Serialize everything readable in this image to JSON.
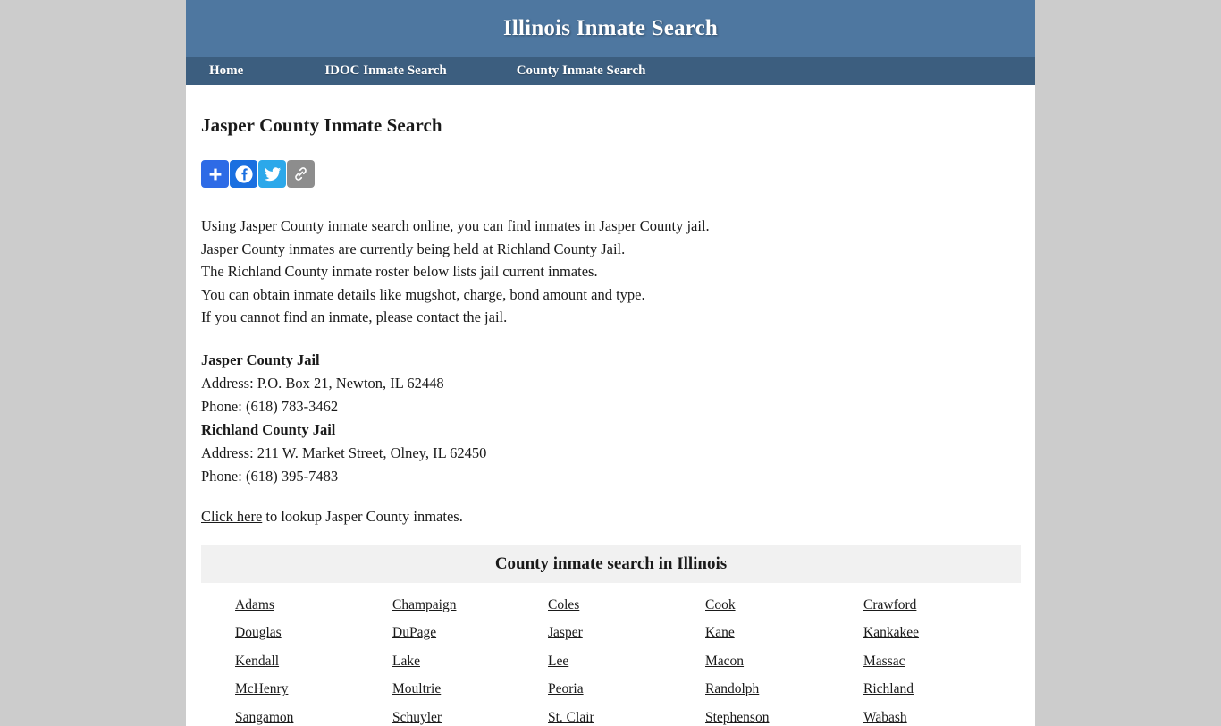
{
  "site": {
    "title": "Illinois Inmate Search",
    "header_bg": "#4e77a0",
    "nav_bg": "#3c5e7f",
    "page_bg": "#cccccc"
  },
  "nav": {
    "items": [
      {
        "label": "Home"
      },
      {
        "label": "IDOC Inmate Search"
      },
      {
        "label": "County Inmate Search"
      }
    ]
  },
  "main": {
    "heading": "Jasper County Inmate Search",
    "share": [
      {
        "name": "addthis-share-button",
        "icon": "plus-icon",
        "color": "#2e6be6"
      },
      {
        "name": "facebook-share-button",
        "icon": "facebook-icon",
        "color": "#1a6fe0"
      },
      {
        "name": "twitter-share-button",
        "icon": "twitter-icon",
        "color": "#2ca8ea"
      },
      {
        "name": "copy-link-button",
        "icon": "link-icon",
        "color": "#8d8d8d"
      }
    ],
    "intro": [
      "Using Jasper County inmate search online, you can find inmates in Jasper County jail.",
      "Jasper County inmates are currently being held at Richland County Jail.",
      "The Richland County inmate roster below lists jail current inmates.",
      "You can obtain inmate details like mugshot, charge, bond amount and type.",
      "If you cannot find an inmate, please contact the jail."
    ],
    "jails": [
      {
        "name": "Jasper County Jail",
        "address": "Address: P.O. Box 21, Newton, IL 62448",
        "phone": "Phone: (618) 783-3462"
      },
      {
        "name": "Richland County Jail",
        "address": "Address: 211 W. Market Street, Olney, IL 62450",
        "phone": "Phone: (618) 395-7483"
      }
    ],
    "lookup": {
      "link_text": "Click here",
      "rest_text": " to lookup Jasper County inmates."
    }
  },
  "county_table": {
    "title": "County inmate search in Illinois",
    "counties": [
      "Adams",
      "Champaign",
      "Coles",
      "Cook",
      "Crawford",
      "Douglas",
      "DuPage",
      "Jasper",
      "Kane",
      "Kankakee",
      "Kendall",
      "Lake",
      "Lee",
      "Macon",
      "Massac",
      "McHenry",
      "Moultrie",
      "Peoria",
      "Randolph",
      "Richland",
      "Sangamon",
      "Schuyler",
      "St. Clair",
      "Stephenson",
      "Wabash"
    ]
  }
}
